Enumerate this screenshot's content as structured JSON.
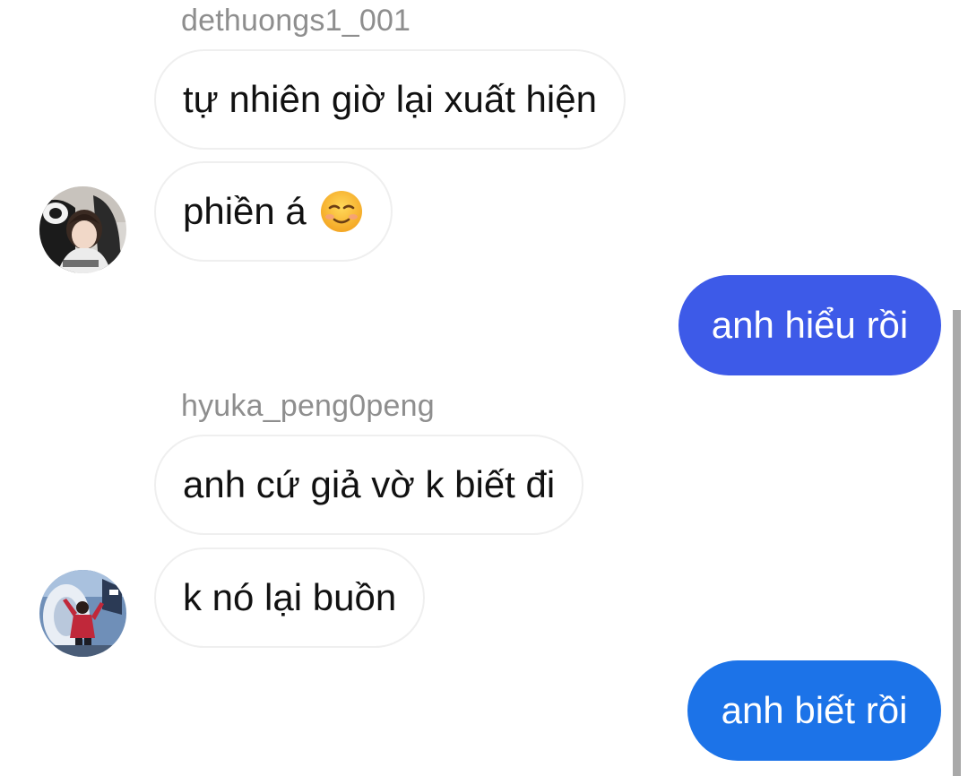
{
  "messages": [
    {
      "sender": "dethuongs1_001",
      "bubbles": [
        "tự nhiên giờ lại xuất hiện",
        "phiền á"
      ],
      "emoji": "smiling-face-icon"
    },
    {
      "outgoing": "anh hiểu rồi"
    },
    {
      "sender": "hyuka_peng0peng",
      "bubbles": [
        "anh cứ giả vờ k biết đi",
        "k nó lại buồn"
      ]
    },
    {
      "outgoing": "anh biết rồi"
    }
  ],
  "colors": {
    "outgoing_1": "#3d5ae8",
    "outgoing_2": "#1c73e8",
    "incoming_border": "#efefef",
    "sender_name": "#8e8e8e"
  }
}
